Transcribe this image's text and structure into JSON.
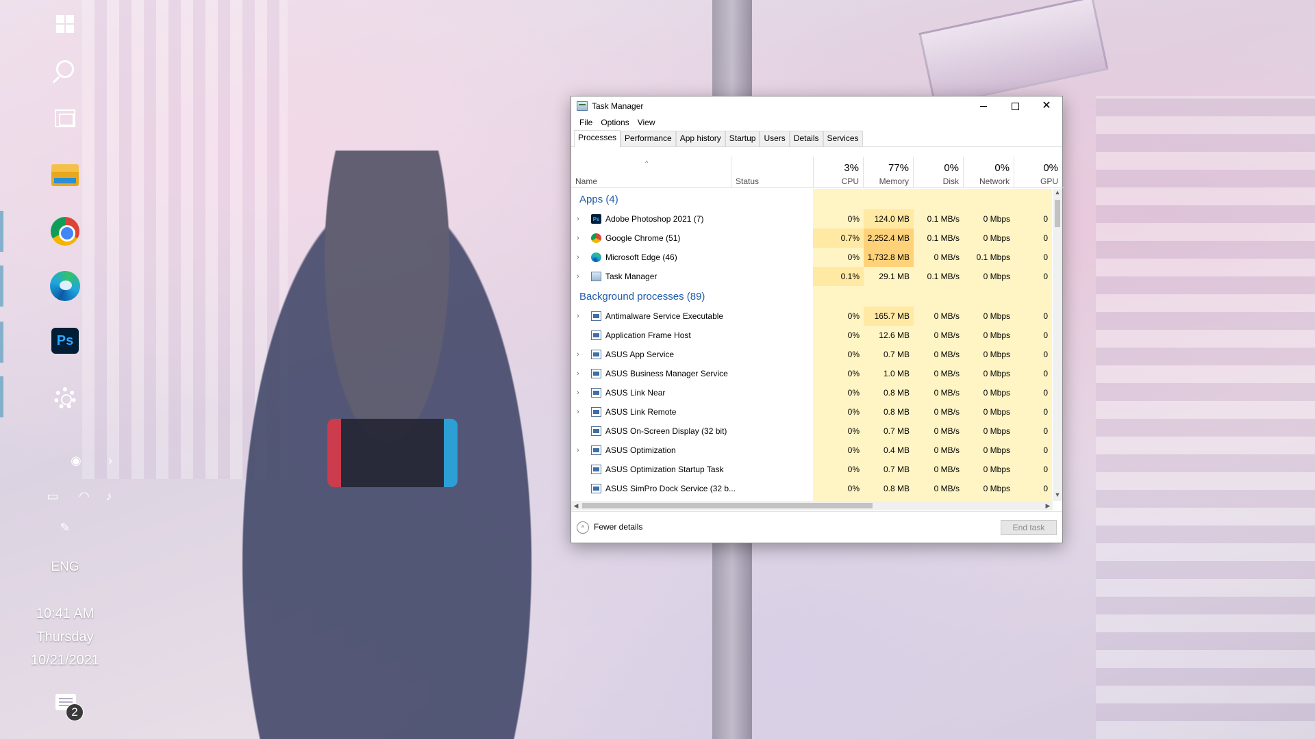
{
  "desktop": {
    "taskbar": {
      "items": [
        {
          "name": "start",
          "icon": "windows-icon"
        },
        {
          "name": "search",
          "icon": "search-icon"
        },
        {
          "name": "task-view",
          "icon": "task-view-icon"
        },
        {
          "name": "file-explorer",
          "icon": "folder-icon"
        },
        {
          "name": "chrome",
          "icon": "chrome-icon"
        },
        {
          "name": "edge",
          "icon": "edge-icon"
        },
        {
          "name": "photoshop",
          "icon": "photoshop-icon",
          "label": "Ps"
        },
        {
          "name": "settings",
          "icon": "gear-icon"
        }
      ],
      "tray": {
        "language": "ENG",
        "time": "10:41 AM",
        "day": "Thursday",
        "date": "10/21/2021",
        "notification_count": "2"
      }
    }
  },
  "task_manager": {
    "title": "Task Manager",
    "menu": [
      "File",
      "Options",
      "View"
    ],
    "tabs": [
      "Processes",
      "Performance",
      "App history",
      "Startup",
      "Users",
      "Details",
      "Services"
    ],
    "active_tab": "Processes",
    "columns": {
      "name": "Name",
      "status": "Status",
      "cpu": {
        "label": "CPU",
        "pct": "3%"
      },
      "memory": {
        "label": "Memory",
        "pct": "77%"
      },
      "disk": {
        "label": "Disk",
        "pct": "0%"
      },
      "network": {
        "label": "Network",
        "pct": "0%"
      },
      "gpu": {
        "label": "GPU",
        "pct": "0%"
      }
    },
    "groups": {
      "apps": {
        "title": "Apps (4)",
        "rows": [
          {
            "name": "Adobe Photoshop 2021 (7)",
            "icon": "photoshop-icon",
            "cpu": "0%",
            "memory": "124.0 MB",
            "disk": "0.1 MB/s",
            "network": "0 Mbps",
            "gpu": "0",
            "expandable": true
          },
          {
            "name": "Google Chrome (51)",
            "icon": "chrome-icon",
            "cpu": "0.7%",
            "memory": "2,252.4 MB",
            "disk": "0.1 MB/s",
            "network": "0 Mbps",
            "gpu": "0",
            "expandable": true
          },
          {
            "name": "Microsoft Edge (46)",
            "icon": "edge-icon",
            "cpu": "0%",
            "memory": "1,732.8 MB",
            "disk": "0 MB/s",
            "network": "0.1 Mbps",
            "gpu": "0",
            "expandable": true
          },
          {
            "name": "Task Manager",
            "icon": "task-manager-icon",
            "cpu": "0.1%",
            "memory": "29.1 MB",
            "disk": "0.1 MB/s",
            "network": "0 Mbps",
            "gpu": "0",
            "expandable": true
          }
        ]
      },
      "background": {
        "title": "Background processes (89)",
        "rows": [
          {
            "name": "Antimalware Service Executable",
            "cpu": "0%",
            "memory": "165.7 MB",
            "disk": "0 MB/s",
            "network": "0 Mbps",
            "gpu": "0",
            "expandable": true
          },
          {
            "name": "Application Frame Host",
            "cpu": "0%",
            "memory": "12.6 MB",
            "disk": "0 MB/s",
            "network": "0 Mbps",
            "gpu": "0",
            "expandable": false
          },
          {
            "name": "ASUS App Service",
            "cpu": "0%",
            "memory": "0.7 MB",
            "disk": "0 MB/s",
            "network": "0 Mbps",
            "gpu": "0",
            "expandable": true
          },
          {
            "name": "ASUS Business Manager Service",
            "cpu": "0%",
            "memory": "1.0 MB",
            "disk": "0 MB/s",
            "network": "0 Mbps",
            "gpu": "0",
            "expandable": true
          },
          {
            "name": "ASUS Link Near",
            "cpu": "0%",
            "memory": "0.8 MB",
            "disk": "0 MB/s",
            "network": "0 Mbps",
            "gpu": "0",
            "expandable": true
          },
          {
            "name": "ASUS Link Remote",
            "cpu": "0%",
            "memory": "0.8 MB",
            "disk": "0 MB/s",
            "network": "0 Mbps",
            "gpu": "0",
            "expandable": true
          },
          {
            "name": "ASUS On-Screen Display (32 bit)",
            "cpu": "0%",
            "memory": "0.7 MB",
            "disk": "0 MB/s",
            "network": "0 Mbps",
            "gpu": "0",
            "expandable": false
          },
          {
            "name": "ASUS Optimization",
            "cpu": "0%",
            "memory": "0.4 MB",
            "disk": "0 MB/s",
            "network": "0 Mbps",
            "gpu": "0",
            "expandable": true
          },
          {
            "name": "ASUS Optimization Startup Task",
            "cpu": "0%",
            "memory": "0.7 MB",
            "disk": "0 MB/s",
            "network": "0 Mbps",
            "gpu": "0",
            "expandable": false
          },
          {
            "name": "ASUS SimPro Dock Service (32 b...",
            "cpu": "0%",
            "memory": "0.8 MB",
            "disk": "0 MB/s",
            "network": "0 Mbps",
            "gpu": "0",
            "expandable": false
          }
        ]
      }
    },
    "footer": {
      "fewer_details": "Fewer details",
      "end_task": "End task"
    },
    "colors": {
      "group_title": "#1e5aa8",
      "heat_low": "#fff4c4",
      "heat_mid": "#ffe9a3",
      "heat_high": "#ffd27a"
    }
  }
}
